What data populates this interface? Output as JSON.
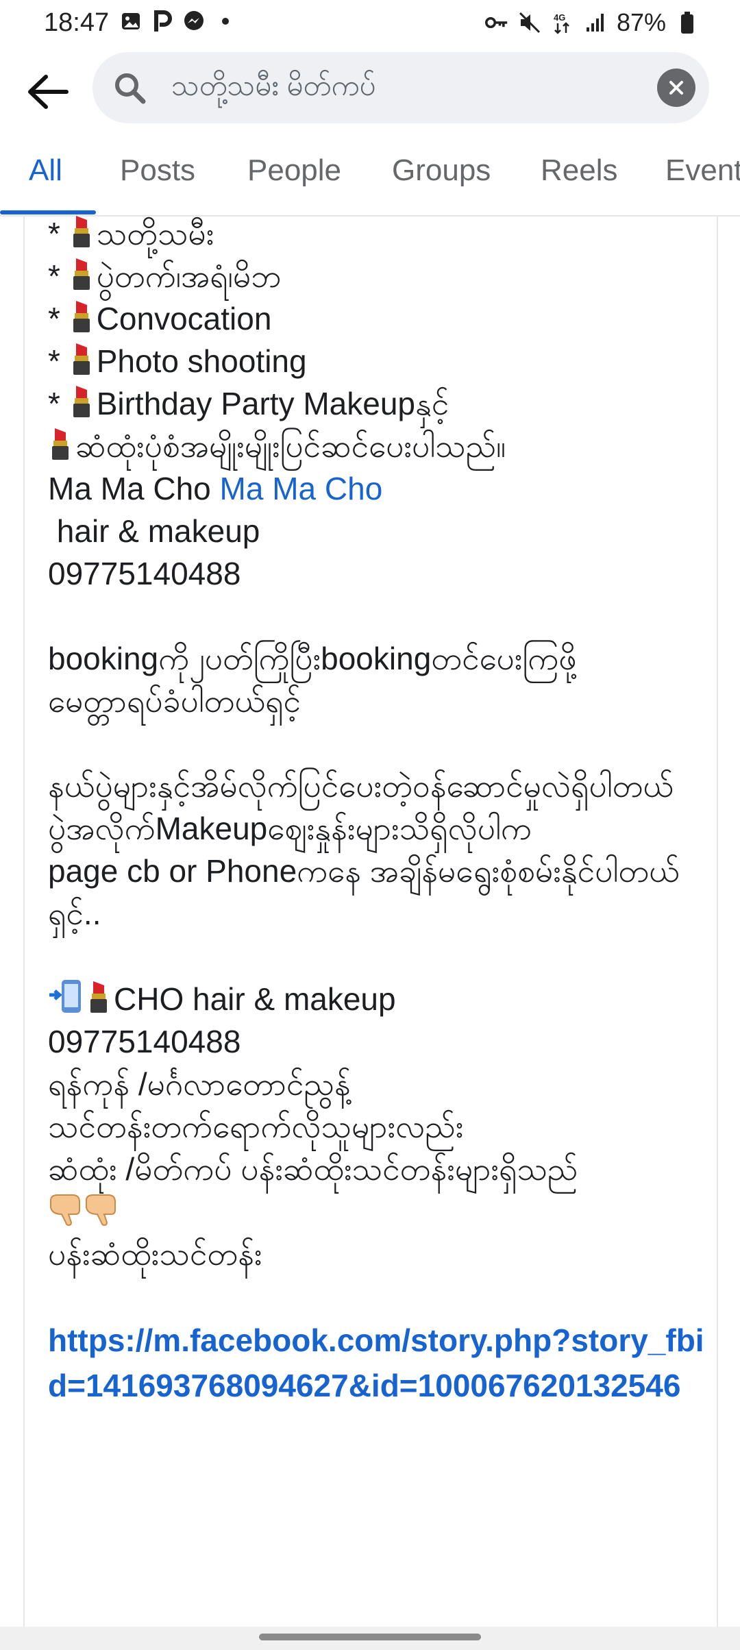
{
  "status_bar": {
    "time": "18:47",
    "battery": "87%",
    "network": "4G",
    "icons": [
      "gallery-icon",
      "p-icon",
      "messenger-icon",
      "dot-icon",
      "key-icon",
      "mute-icon",
      "signal-icon",
      "battery-icon"
    ]
  },
  "search": {
    "query": "သတို့သမီး မိတ်ကပ်"
  },
  "tabs": [
    "All",
    "Posts",
    "People",
    "Groups",
    "Reels",
    "Events"
  ],
  "active_tab": "All",
  "post": {
    "lines": [
      "* ",
      "သတို့သမီး",
      "* ",
      "ပွဲတက်၊အရံ၊မိဘ",
      "* ",
      "Convocation",
      "* ",
      "Photo shooting",
      "* ",
      "Birthday Party Makeupနှင့်",
      "ဆံထုံးပုံစံအမျိုးမျိုးပြင်ဆင်ပေးပါသည်။"
    ],
    "author_plain": "Ma Ma Cho",
    "author_link": "Ma Ma Cho",
    "line_hair": " hair & makeup",
    "phone1": "09775140488",
    "booking": "bookingကို၂ပတ်ကြိုပြီးbookingတင်ပေးကြဖို့မေတ္တာရပ်ခံပါတယ်ရှင့်",
    "wedding": "နယ်ပွဲများနှင့်အိမ်လိုက်ပြင်ပေးတဲ့ဝန်ဆောင်မှုလဲရှိပါတယ်",
    "price": "ပွဲအလိုက်Makeupဈေးနှုန်းများသိရှိလိုပါက",
    "contact": "page cb or Phoneကနေ အချိန်မရွေးစုံစမ်းနိုင်ပါတယ်ရှင့်..",
    "brand": "CHO hair & makeup",
    "phone2": "09775140488",
    "location": "ရန်ကုန် /မင်္ဂလာတောင်ညွန့်",
    "training": "သင်တန်းတက်ရောက်လိုသူများလည်း",
    "courses": "ဆံထုံး /မိတ်ကပ် ပန်းဆံထိုးသင်တန်းများရှိသည်",
    "course_title": "ပန်းဆံထိုးသင်တန်း",
    "url": "https://m.facebook.com/story.php?story_fbid=141693768094627&id=100067620132546"
  },
  "colors": {
    "accent": "#1763cf",
    "text": "#1c1e21",
    "muted": "#65676b"
  }
}
